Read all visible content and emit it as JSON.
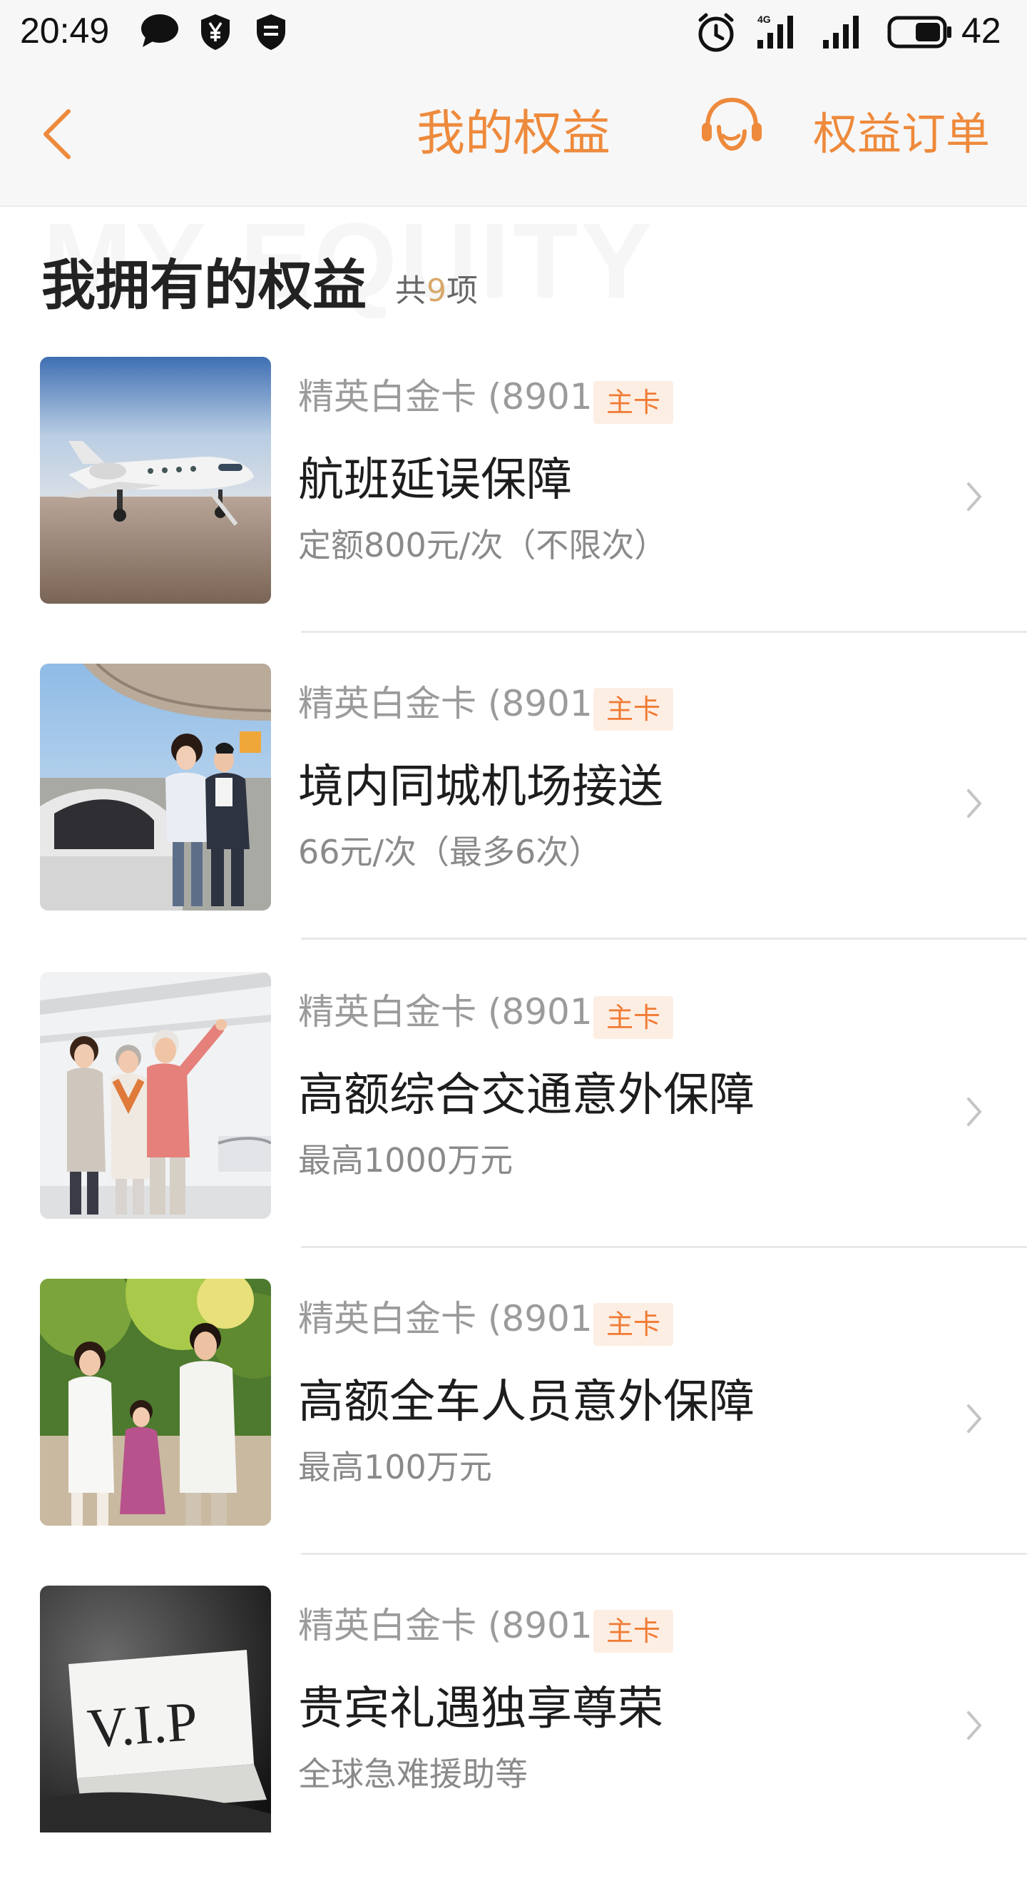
{
  "status_bar": {
    "time": "20:49",
    "battery": "42",
    "icons": [
      "message-icon",
      "yuan-shield-icon",
      "shield-icon",
      "alarm-icon",
      "signal-4g-icon",
      "signal-icon",
      "battery-icon"
    ]
  },
  "nav": {
    "title": "我的权益",
    "orders_label": "权益订单",
    "back_icon": "chevron-left-icon",
    "service_icon": "customer-service-icon",
    "accent_color": "#ee8a3c"
  },
  "section": {
    "watermark": "MY EQUITY",
    "title": "我拥有的权益",
    "count_prefix": "共",
    "count": "9",
    "count_suffix": "项"
  },
  "items": [
    {
      "card": "精英白金卡 (8901)",
      "badge": "主卡",
      "title": "航班延误保障",
      "desc": "定额800元/次（不限次）",
      "image": "private-jet-photo"
    },
    {
      "card": "精英白金卡 (8901)",
      "badge": "主卡",
      "title": "境内同城机场接送",
      "desc": "66元/次（最多6次）",
      "image": "airport-car-photo"
    },
    {
      "card": "精英白金卡 (8901)",
      "badge": "主卡",
      "title": "高额综合交通意外保障",
      "desc": "最高1000万元",
      "image": "family-train-photo"
    },
    {
      "card": "精英白金卡 (8901)",
      "badge": "主卡",
      "title": "高额全车人员意外保障",
      "desc": "最高100万元",
      "image": "family-walk-photo"
    },
    {
      "card": "精英白金卡 (8901)",
      "badge": "主卡",
      "title": "贵宾礼遇独享尊荣",
      "desc": "全球急难援助等",
      "image": "vip-card-photo"
    }
  ]
}
